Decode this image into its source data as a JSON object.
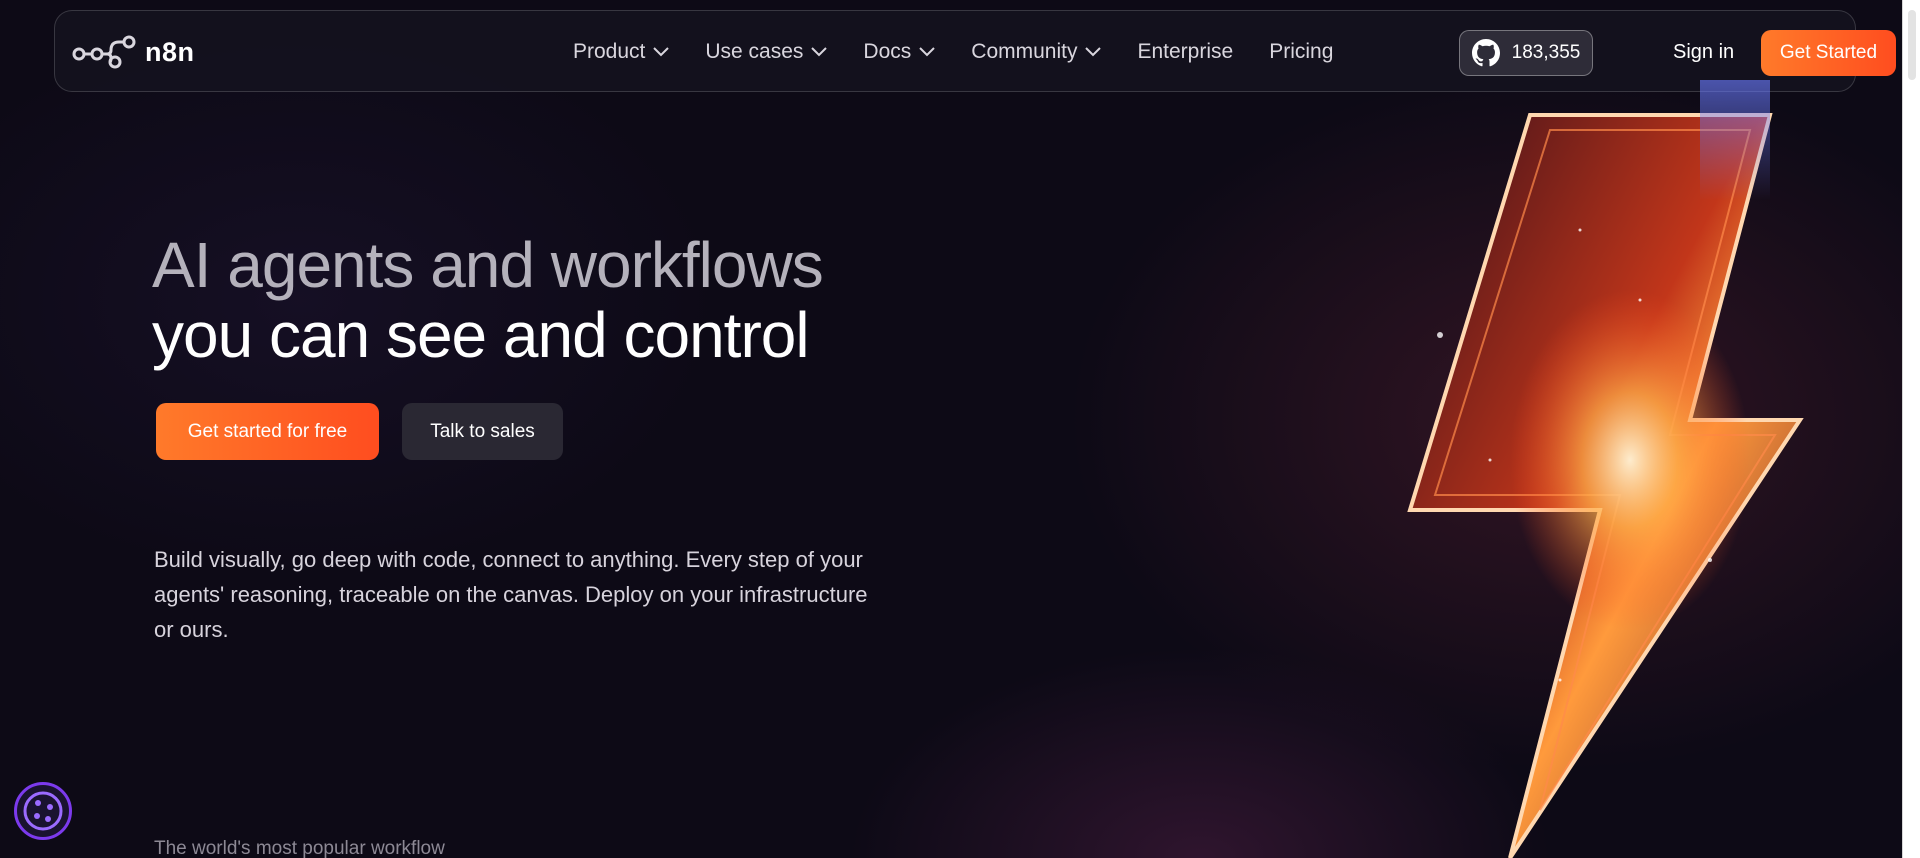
{
  "brand": {
    "name": "n8n",
    "logo_icon": "n8n-logo-icon"
  },
  "nav": {
    "items": [
      {
        "label": "Product",
        "has_dropdown": true
      },
      {
        "label": "Use cases",
        "has_dropdown": true
      },
      {
        "label": "Docs",
        "has_dropdown": true
      },
      {
        "label": "Community",
        "has_dropdown": true
      },
      {
        "label": "Enterprise",
        "has_dropdown": false
      },
      {
        "label": "Pricing",
        "has_dropdown": false
      }
    ],
    "github_stars": "183,355",
    "github_icon": "github-icon",
    "sign_in": "Sign in",
    "get_started": "Get Started"
  },
  "hero": {
    "title_line1": "AI agents and workflows",
    "title_line2": "you can see and control",
    "primary_cta": "Get started for free",
    "secondary_cta": "Talk to sales",
    "description": "Build visually, go deep with code, connect to anything. Every step of your agents' reasoning, traceable on the canvas. Deploy on your infrastructure or ours.",
    "tagline": "The world's most popular workflow"
  },
  "colors": {
    "background": "#0d0a16",
    "accent_orange": "#ff5a1f",
    "secondary_button": "#2a2833",
    "badge_purple": "#7c3aed"
  },
  "floating_badge": {
    "icon": "cookie-settings-icon"
  }
}
